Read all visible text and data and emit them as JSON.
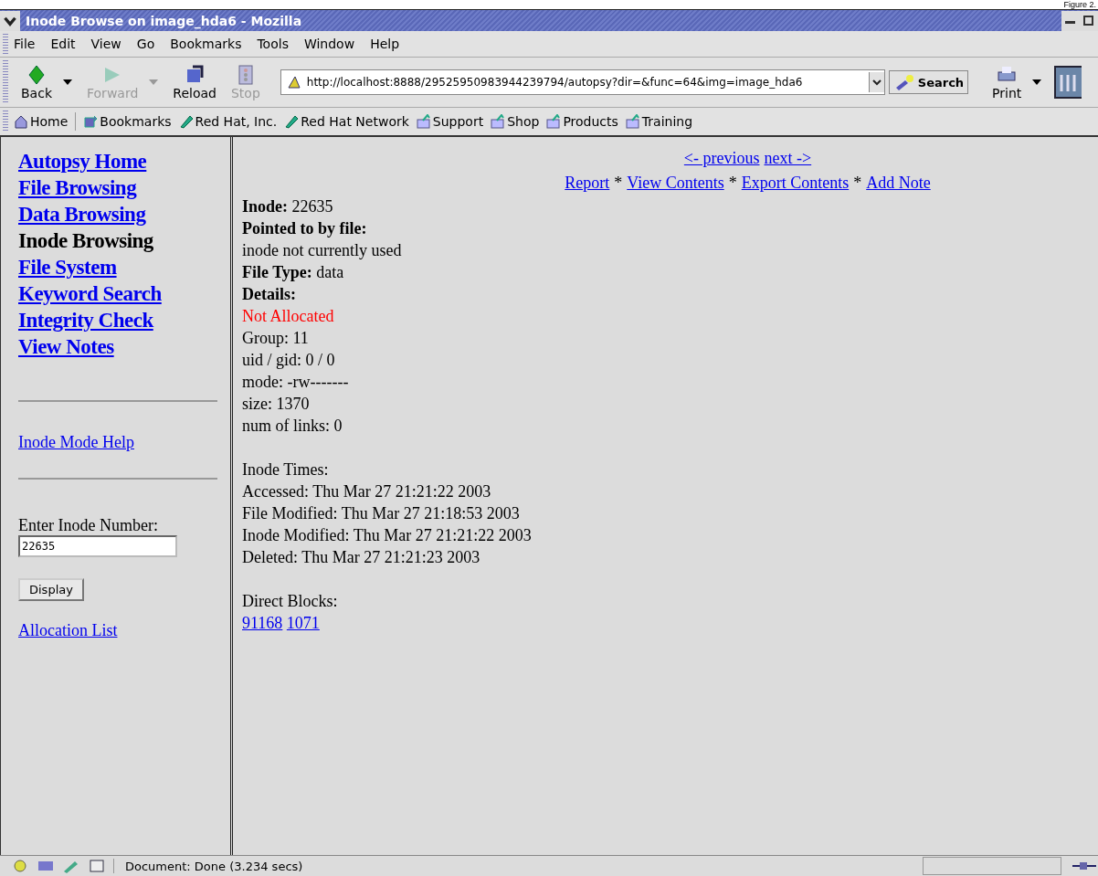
{
  "caption": "Figure 2.",
  "window": {
    "title": "Inode Browse on image_hda6 - Mozilla"
  },
  "menu": [
    "File",
    "Edit",
    "View",
    "Go",
    "Bookmarks",
    "Tools",
    "Window",
    "Help"
  ],
  "toolbar": {
    "buttons": [
      {
        "label": "Back",
        "kind": "back",
        "disabled": false
      },
      {
        "label": "Forward",
        "kind": "forward",
        "disabled": true
      },
      {
        "label": "Reload",
        "kind": "reload",
        "disabled": false
      },
      {
        "label": "Stop",
        "kind": "stop",
        "disabled": true
      }
    ],
    "url": "http://localhost:8888/29525950983944239794/autopsy?dir=&func=64&img=image_hda6",
    "search": "Search",
    "print": "Print"
  },
  "bookmarks": [
    {
      "label": "Home",
      "kind": "home"
    },
    {
      "label": "Bookmarks",
      "kind": "bookmarks"
    },
    {
      "label": "Red Hat, Inc.",
      "kind": "pen"
    },
    {
      "label": "Red Hat Network",
      "kind": "pen"
    },
    {
      "label": "Support",
      "kind": "folder"
    },
    {
      "label": "Shop",
      "kind": "folder"
    },
    {
      "label": "Products",
      "kind": "folder"
    },
    {
      "label": "Training",
      "kind": "folder"
    }
  ],
  "sidebar": {
    "items": [
      {
        "label": "Autopsy Home",
        "selected": false
      },
      {
        "label": "File Browsing",
        "selected": false
      },
      {
        "label": "Data Browsing",
        "selected": false
      },
      {
        "label": "Inode Browsing",
        "selected": true
      },
      {
        "label": "File System",
        "selected": false
      },
      {
        "label": "Keyword Search",
        "selected": false
      },
      {
        "label": "Integrity Check",
        "selected": false
      },
      {
        "label": "View Notes",
        "selected": false
      }
    ],
    "help_link": "Inode Mode Help",
    "field_label": "Enter Inode Number:",
    "field_value": "22635",
    "display_button": "Display",
    "allocation_link": "Allocation List"
  },
  "nav": {
    "links": [
      "<- previous",
      "next ->"
    ],
    "actions": [
      "Report",
      "View Contents",
      "Export Contents",
      "Add Note"
    ],
    "separator": "*"
  },
  "details": [
    [
      {
        "text": "**Inode:** 22635",
        "kind": "text"
      },
      {
        "text": "Pointed to by file:",
        "kind": "heading"
      },
      {
        "text": "inode not currently used",
        "kind": "text"
      },
      {
        "text": "**File Type:** data",
        "kind": "text"
      },
      {
        "text": "Details:",
        "kind": "heading"
      },
      {
        "text": "Not Allocated",
        "kind": "alert"
      },
      {
        "text": "Group: 11",
        "kind": "text"
      },
      {
        "text": "uid / gid: 0 / 0",
        "kind": "text"
      },
      {
        "text": "mode: -rw-------",
        "kind": "text"
      },
      {
        "text": "size: 1370",
        "kind": "text"
      },
      {
        "text": "num of links: 0",
        "kind": "text"
      }
    ],
    [
      {
        "text": "Inode Times:",
        "kind": "text"
      },
      {
        "text": "Accessed: Thu Mar 27 21:21:22 2003",
        "kind": "text"
      },
      {
        "text": "File Modified: Thu Mar 27 21:18:53 2003",
        "kind": "text"
      },
      {
        "text": "Inode Modified: Thu Mar 27 21:21:22 2003",
        "kind": "text"
      },
      {
        "text": "Deleted: Thu Mar 27 21:21:23 2003",
        "kind": "text"
      }
    ],
    [
      {
        "text": "Direct Blocks:",
        "kind": "text"
      }
    ]
  ],
  "blocks": [
    "91168",
    "1071"
  ],
  "status": "Document: Done (3.234 secs)"
}
